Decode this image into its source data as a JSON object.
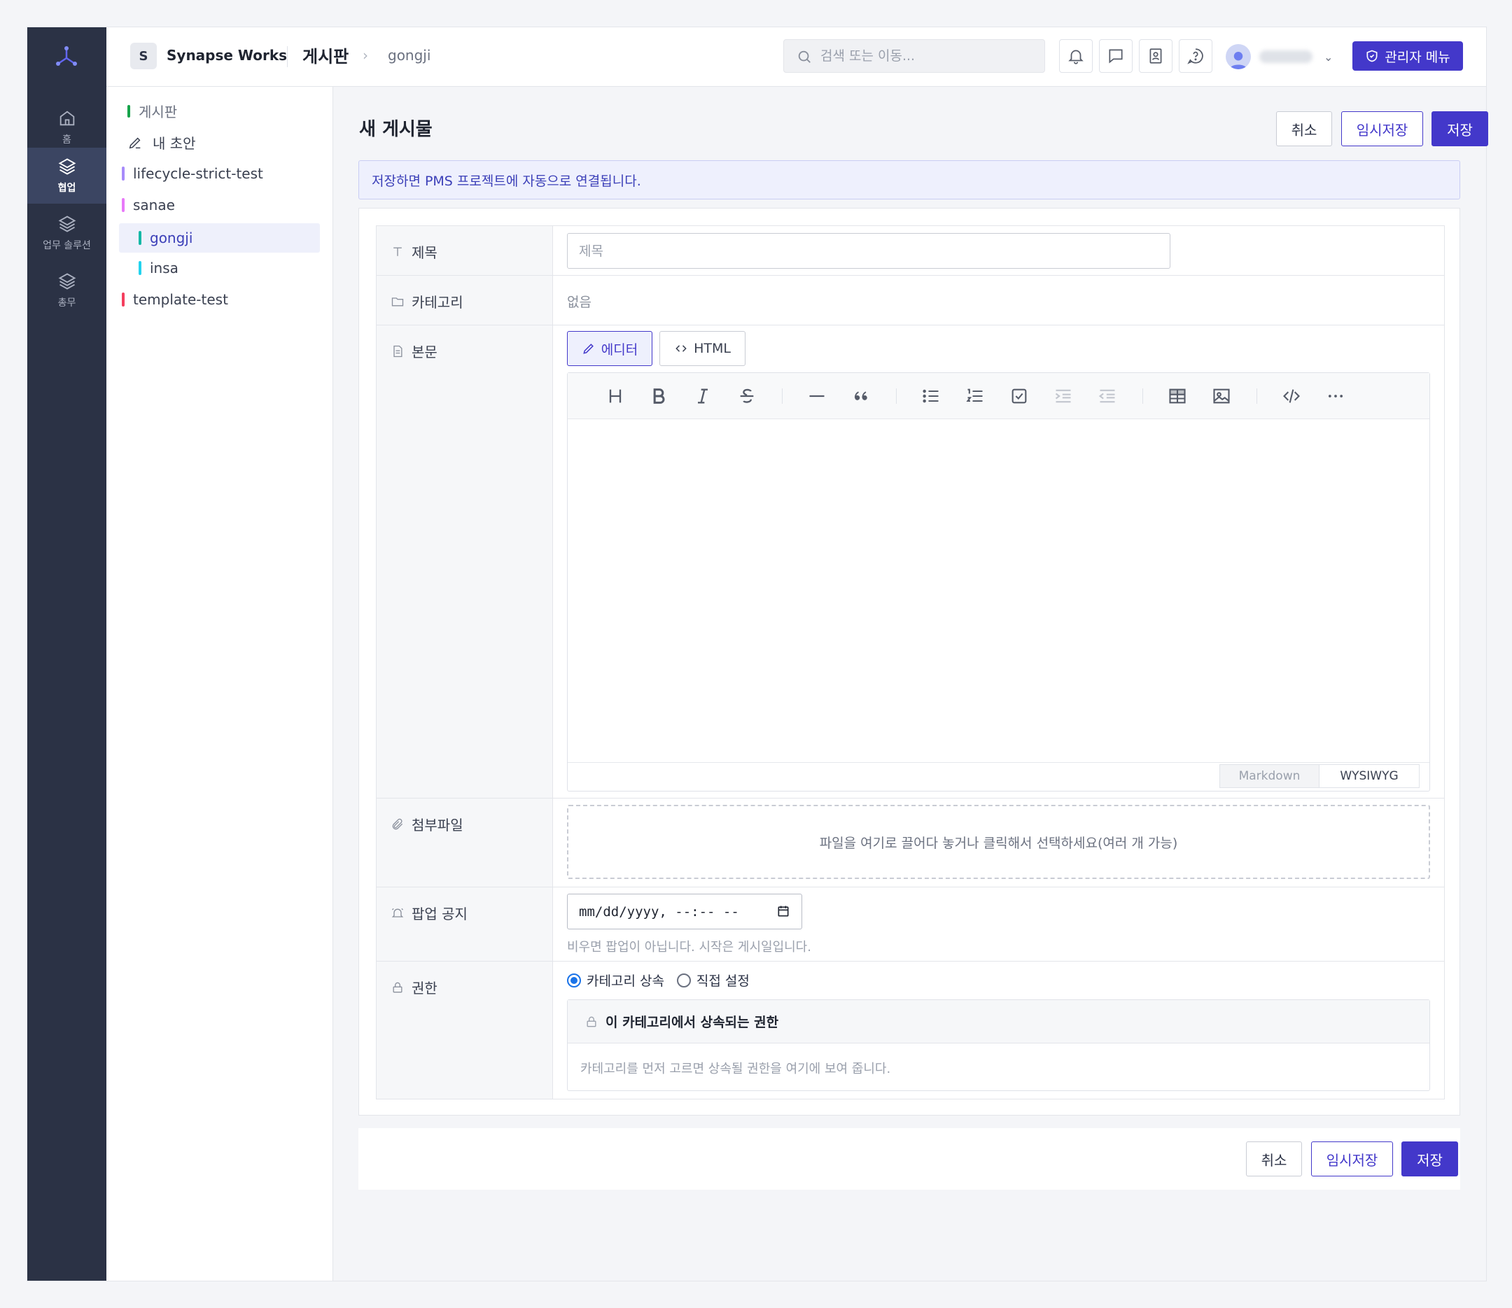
{
  "rail": {
    "items": [
      {
        "label": "홈",
        "icon": "home-icon"
      },
      {
        "label": "협업",
        "icon": "layers-icon",
        "active": true
      },
      {
        "label": "업무 솔루션",
        "icon": "layers-icon"
      },
      {
        "label": "총무",
        "icon": "layers-icon"
      }
    ]
  },
  "header": {
    "workspace_initial": "S",
    "workspace_name": "Synapse Works",
    "section": "게시판",
    "separator": "›",
    "crumb": "gongji",
    "search_placeholder": "검색 또는 이동...",
    "caret": "⌄",
    "admin_label": "관리자 메뉴"
  },
  "tree": {
    "items": [
      {
        "label": "게시판",
        "color": "#16a34a"
      },
      {
        "label": "내 초안",
        "icon": "pencil-icon"
      },
      {
        "label": "lifecycle-strict-test",
        "color": "#a78bfa"
      },
      {
        "label": "sanae",
        "color": "#e879f9"
      },
      {
        "label": "gongji",
        "color": "#14b8a6",
        "selected": true
      },
      {
        "label": "insa",
        "color": "#22d3ee"
      },
      {
        "label": "template-test",
        "color": "#f43f5e"
      }
    ]
  },
  "main": {
    "title": "새 게시물",
    "cancel": "취소",
    "draft": "임시저장",
    "save": "저장",
    "notice": "저장하면 PMS 프로젝트에 자동으로 연결됩니다."
  },
  "form": {
    "title_label": "제목",
    "title_placeholder": "제목",
    "category_label": "카테고리",
    "category_value": "없음",
    "body_label": "본문",
    "mode_editor": "에디터",
    "mode_html": "HTML",
    "tab_markdown": "Markdown",
    "tab_wysiwyg": "WYSIWYG",
    "attach_label": "첨부파일",
    "dropzone_text": "파일을 여기로 끌어다 놓거나 클릭해서 선택하세요(여러 개 가능)",
    "popup_label": "팝업 공지",
    "datetime_value": "mm/dd/yyyy, --:-- --",
    "popup_hint": "비우면 팝업이 아닙니다. 시작은 게시일입니다.",
    "perm_label": "권한",
    "radio_inherit": "카테고리 상속",
    "radio_custom": "직접 설정",
    "perm_head": "이 카테고리에서 상속되는 권한",
    "perm_body": "카테고리를 먼저 고르면 상속될 권한을 여기에 보여 줍니다."
  },
  "colors": {
    "accent": "#4338ca",
    "rail_bg": "#2b3245"
  }
}
